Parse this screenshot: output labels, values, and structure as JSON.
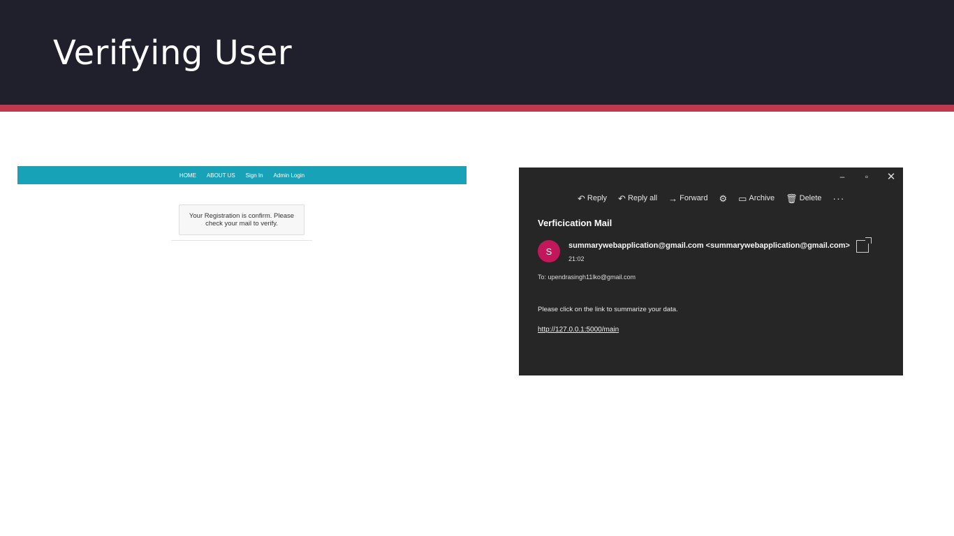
{
  "slide": {
    "title": "Verifying User",
    "colors": {
      "header_bg": "#1f202c",
      "accent": "#c0384d"
    }
  },
  "webapp": {
    "nav": [
      "HOME",
      "ABOUT US",
      "Sign In",
      "Admin Login"
    ],
    "confirmation": "Your Registration is confirm. Please check your mail to verify.",
    "colors": {
      "nav_bg": "#17a2b8"
    }
  },
  "email": {
    "window_controls": {
      "minimize": "–",
      "maximize": "▫",
      "close": "✕"
    },
    "toolbar": [
      {
        "icon": "reply-icon",
        "glyph": "↶",
        "label": "Reply"
      },
      {
        "icon": "reply-all-icon",
        "glyph": "↶",
        "label": "Reply all"
      },
      {
        "icon": "forward-icon",
        "glyph": "→",
        "label": "Forward"
      },
      {
        "icon": "settings-icon",
        "glyph": "⚙",
        "label": ""
      },
      {
        "icon": "archive-icon",
        "glyph": "▭",
        "label": "Archive"
      },
      {
        "icon": "delete-icon",
        "glyph": "🗑",
        "label": "Delete"
      }
    ],
    "more": "···",
    "subject": "Verficication Mail",
    "avatar_initial": "S",
    "sender": "summarywebapplication@gmail.com <summarywebapplication@gmail.com>",
    "time": "21:02",
    "to": "To: upendrasingh11lko@gmail.com",
    "body": "Please click on the link to summarize your data.",
    "link": "http://127.0.0.1:5000/main",
    "colors": {
      "window_bg": "#262626",
      "avatar": "#c2185b"
    }
  }
}
